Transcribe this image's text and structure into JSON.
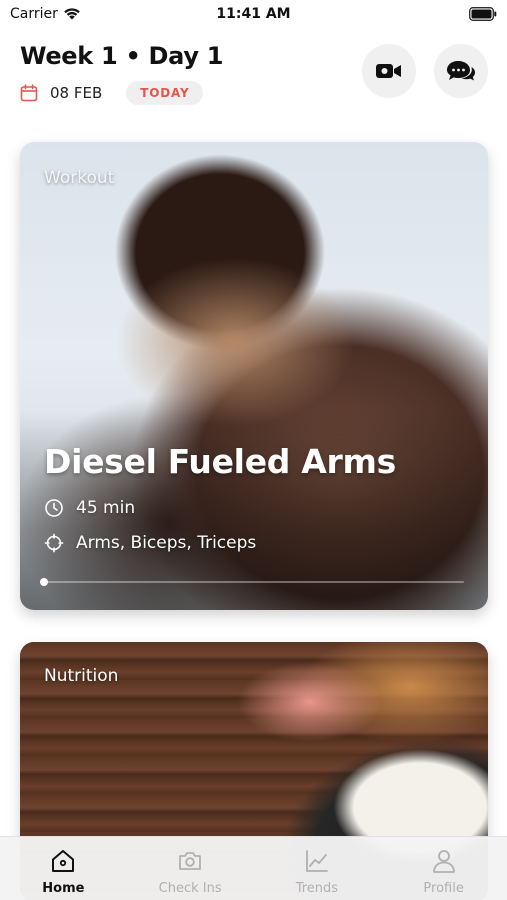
{
  "status_bar": {
    "carrier": "Carrier",
    "time": "11:41 AM"
  },
  "header": {
    "title": "Week 1 • Day 1",
    "date": "08 FEB",
    "today_badge": "TODAY",
    "accent_color": "#e2574c"
  },
  "workout_card": {
    "label": "Workout",
    "title": "Diesel Fueled Arms",
    "duration": "45 min",
    "targets": "Arms, Biceps, Triceps",
    "progress": 0.0
  },
  "nutrition_card": {
    "label": "Nutrition"
  },
  "tabs": [
    {
      "label": "Home",
      "icon": "home-icon",
      "active": true
    },
    {
      "label": "Check Ins",
      "icon": "camera-icon",
      "active": false
    },
    {
      "label": "Trends",
      "icon": "chart-icon",
      "active": false
    },
    {
      "label": "Profile",
      "icon": "profile-icon",
      "active": false
    }
  ]
}
